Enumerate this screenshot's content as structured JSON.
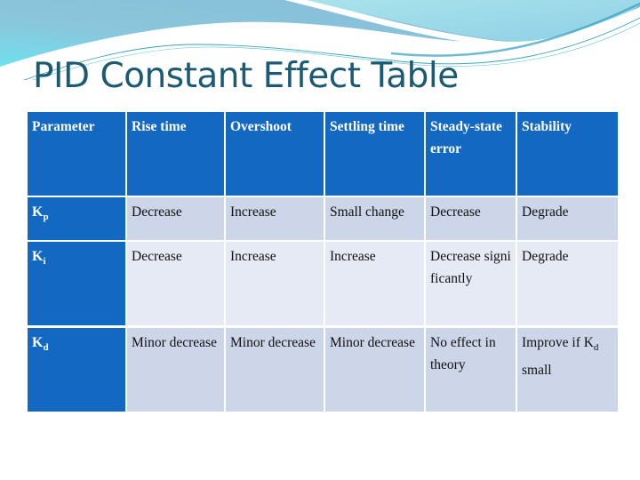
{
  "slide": {
    "title": "PID Constant Effect Table"
  },
  "colors": {
    "header_bg": "#1368c2",
    "row_odd_bg": "#cdd5e9",
    "row_even_bg": "#e6eaf4",
    "title_color": "#1a5a72",
    "wave_light": "#7fd8e8",
    "wave_dark": "#86bcd6"
  },
  "table": {
    "headers": [
      "Parameter",
      "Rise time",
      "Overshoot",
      "Settling time",
      "Steady-state error",
      "Stability"
    ],
    "rows": [
      {
        "param": "K",
        "param_sub": "p",
        "cells": [
          "Decrease",
          "Increase",
          "Small change",
          "Decrease",
          "Degrade"
        ]
      },
      {
        "param": "K",
        "param_sub": "i",
        "cells": [
          "Decrease",
          "Increase",
          "Increase",
          "Decrease significantly",
          "Degrade"
        ]
      },
      {
        "param": "K",
        "param_sub": "d",
        "cells": [
          "Minor decrease",
          "Minor decrease",
          "Minor decrease",
          "No effect in theory"
        ],
        "stability": {
          "pre": "Improve if K",
          "sub": "d",
          "post": " small"
        }
      }
    ]
  }
}
